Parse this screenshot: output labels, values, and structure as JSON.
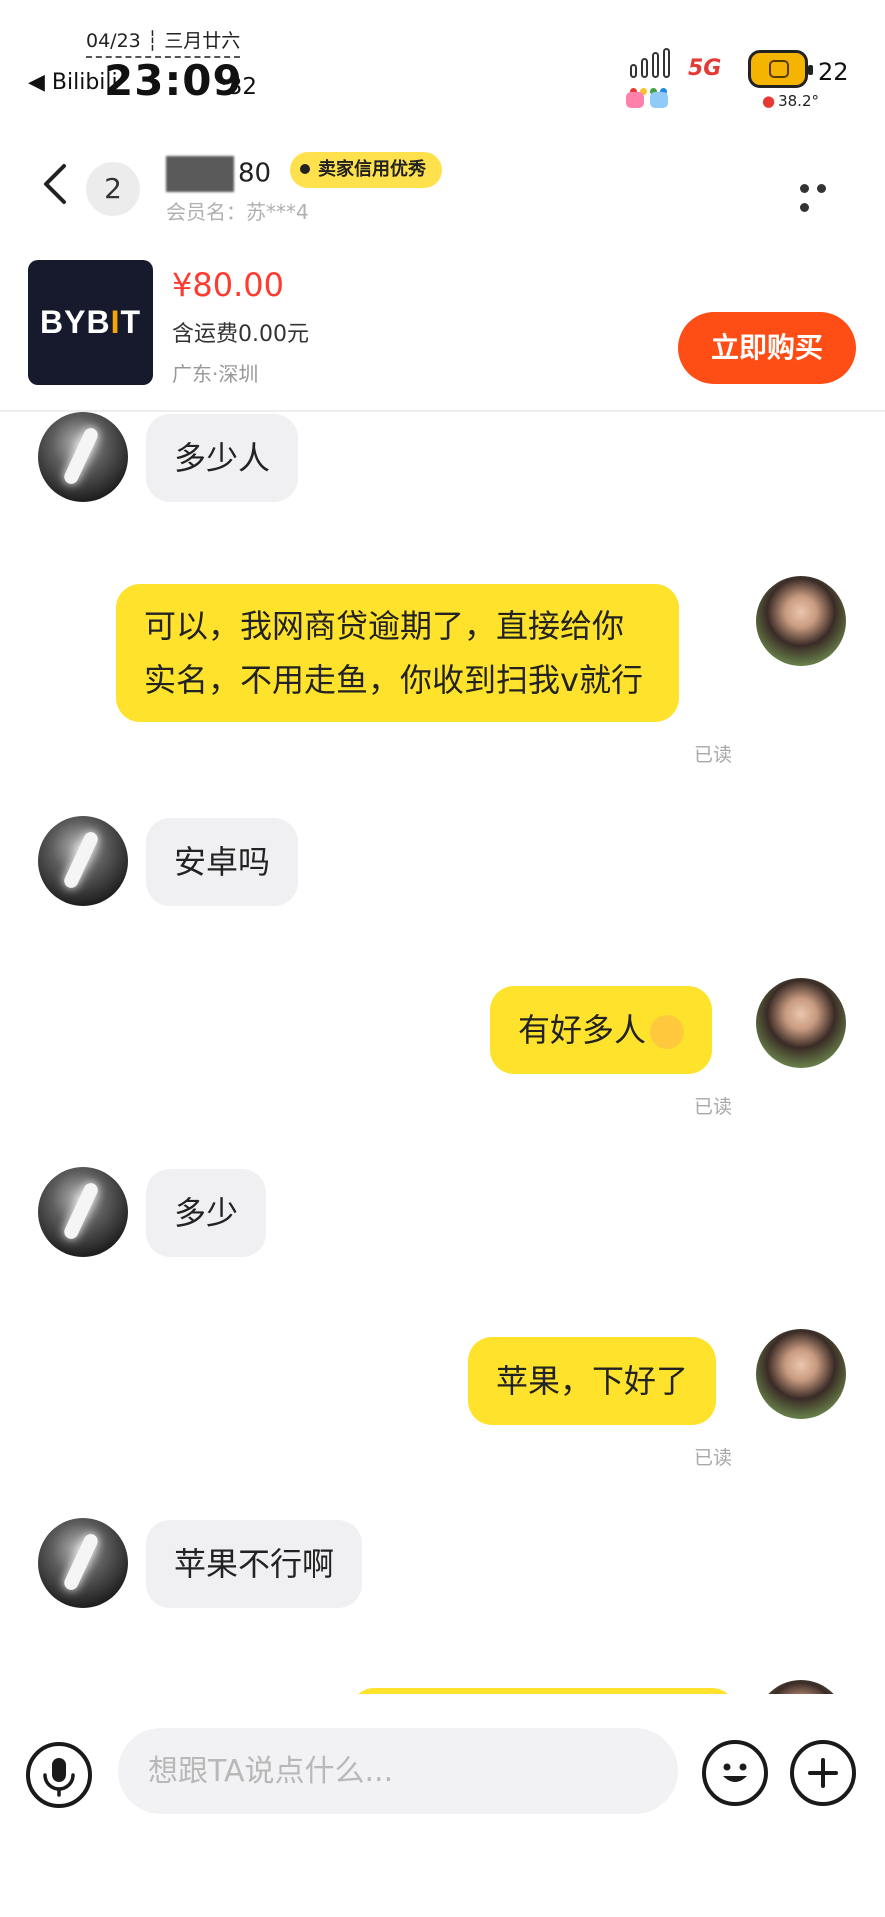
{
  "status_bar": {
    "date": "04/23 ┆ 三月廿六",
    "back_app": "◀ Bilibili",
    "time": "23:09",
    "seconds": ":32",
    "network": "5G",
    "battery_level": "22",
    "temperature": "38.2°"
  },
  "header": {
    "unread_count": "2",
    "seller_name_suffix": "80",
    "credit_badge": "卖家信用优秀",
    "member_name": "会员名：苏***4"
  },
  "product": {
    "logo_text_a": "BYB",
    "logo_text_b": "I",
    "logo_text_c": "T",
    "price": "¥80.00",
    "shipping": "含运费0.00元",
    "location": "广东·深圳",
    "buy_label": "立即购买"
  },
  "messages": [
    {
      "sender": "other",
      "text": "多少人"
    },
    {
      "sender": "self",
      "text_line1": "可以，我网商贷逾期了，直接给你",
      "text_line2": "实名，不用走鱼，你收到扫我v就行",
      "status": "已读"
    },
    {
      "sender": "other",
      "text": "安卓吗"
    },
    {
      "sender": "self",
      "text": "有好多人",
      "status": "已读"
    },
    {
      "sender": "other",
      "text": "多少"
    },
    {
      "sender": "self",
      "text": "苹果，下好了",
      "status": "已读"
    },
    {
      "sender": "other",
      "text": "苹果不行啊"
    }
  ],
  "input": {
    "placeholder": "想跟TA说点什么..."
  },
  "icons": {
    "mic": "microphone-icon",
    "emoji": "smiley-icon",
    "plus": "plus-icon"
  },
  "colors": {
    "accent_yellow": "#ffe22c",
    "buy_button": "#ff4d16",
    "price_red": "#ff3b30"
  }
}
